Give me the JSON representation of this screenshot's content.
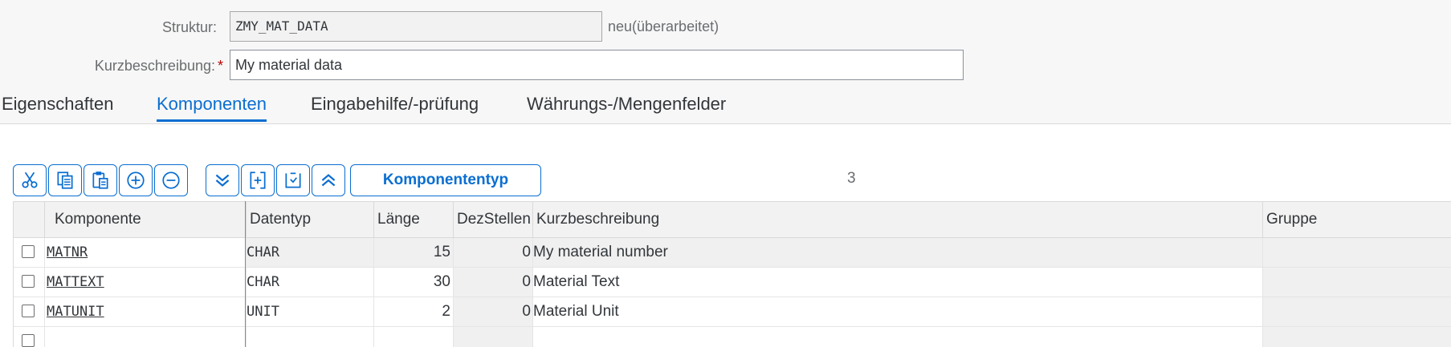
{
  "form": {
    "struktur": {
      "label": "Struktur:",
      "value": "ZMY_MAT_DATA",
      "suffix": "neu(überarbeitet)"
    },
    "kurzbeschreibung": {
      "label": "Kurzbeschreibung:",
      "required_mark": "*",
      "value": "My material data"
    }
  },
  "tabs": [
    {
      "label": "Eigenschaften",
      "active": false
    },
    {
      "label": "Komponenten",
      "active": true
    },
    {
      "label": "Eingabehilfe/-prüfung",
      "active": false
    },
    {
      "label": "Währungs-/Mengenfelder",
      "active": false
    }
  ],
  "toolbar": {
    "icons": [
      "cut-icon",
      "copy-icon",
      "paste-icon",
      "insert-row-icon",
      "delete-row-icon",
      "scroll-bottom-icon",
      "append-row-icon",
      "select-block-icon",
      "scroll-top-icon"
    ],
    "komponententyp_label": "Komponententyp",
    "count": "3"
  },
  "grid": {
    "columns": [
      "Komponente",
      "Datentyp",
      "Länge",
      "DezStellen",
      "Kurzbeschreibung",
      "Gruppe"
    ],
    "rows": [
      {
        "komponente": "MATNR",
        "datentyp": "CHAR",
        "laenge": "15",
        "dezstellen": "0",
        "kurzbeschreibung": "My material number",
        "gruppe": ""
      },
      {
        "komponente": "MATTEXT",
        "datentyp": "CHAR",
        "laenge": "30",
        "dezstellen": "0",
        "kurzbeschreibung": "Material Text",
        "gruppe": ""
      },
      {
        "komponente": "MATUNIT",
        "datentyp": "UNIT",
        "laenge": "2",
        "dezstellen": "0",
        "kurzbeschreibung": "Material Unit",
        "gruppe": ""
      },
      {
        "komponente": "",
        "datentyp": "",
        "laenge": "",
        "dezstellen": "",
        "kurzbeschreibung": "",
        "gruppe": ""
      }
    ]
  },
  "colors": {
    "accent": "#0a6ed1",
    "required": "#bb0000"
  }
}
